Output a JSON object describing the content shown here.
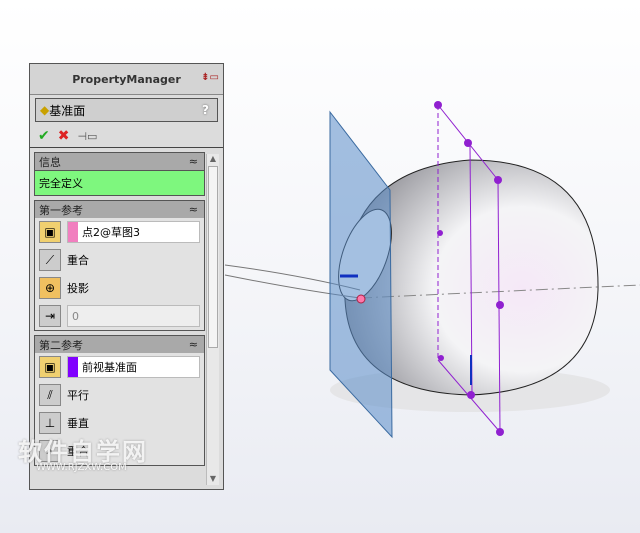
{
  "panel": {
    "header": "PropertyManager",
    "feature_title": "基准面",
    "help": "?"
  },
  "info": {
    "title": "信息",
    "status": "完全定义"
  },
  "first_ref": {
    "title": "第一参考",
    "selection": "点2@草图3",
    "selection_color": "#f17fbf",
    "options": [
      "重合",
      "投影"
    ],
    "value": "0"
  },
  "second_ref": {
    "title": "第二参考",
    "selection": "前视基准面",
    "selection_color": "#8000ff",
    "options": [
      "平行",
      "垂直",
      "重合"
    ]
  },
  "watermark": {
    "main": "软件自学网",
    "url": "WWW.RJZXW.COM"
  },
  "collapse_glyph": "≈"
}
